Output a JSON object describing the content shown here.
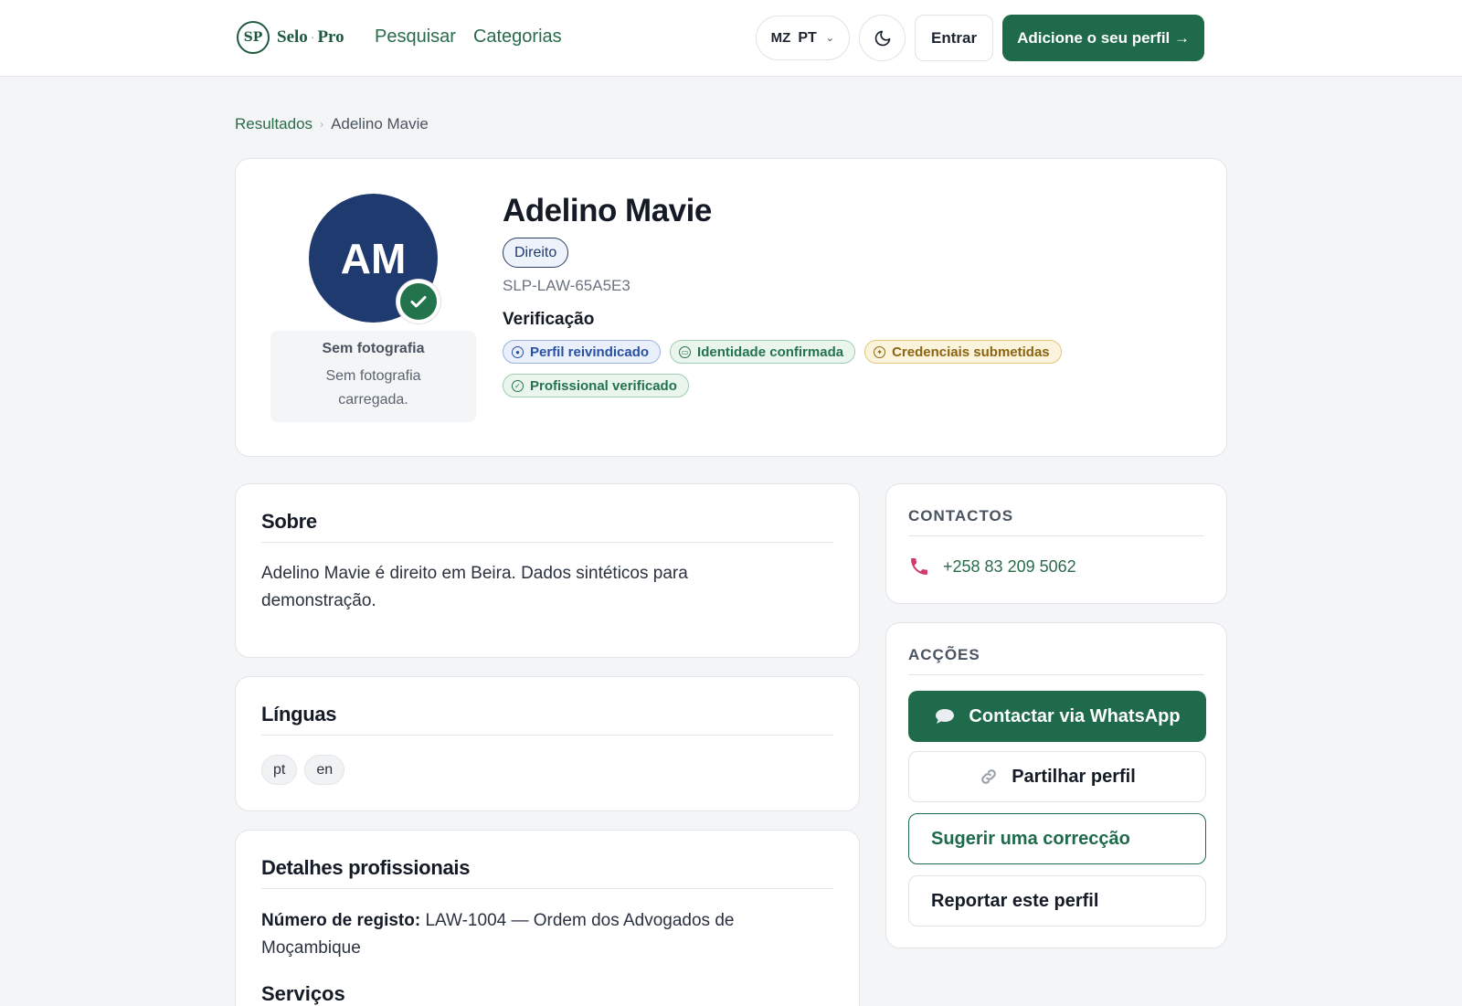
{
  "header": {
    "logo_mark": "SP",
    "logo_name": "Selo",
    "logo_sep": "·",
    "logo_suffix": "Pro",
    "nav": [
      "Pesquisar",
      "Categorias"
    ],
    "country": "MZ",
    "lang": "PT",
    "login": "Entrar",
    "cta": "Adicione o seu perfil →"
  },
  "breadcrumb": {
    "parent": "Resultados",
    "current": "Adelino Mavie"
  },
  "profile": {
    "initials": "AM",
    "name": "Adelino Mavie",
    "category": "Direito",
    "id": "SLP-LAW-65A5E3",
    "no_photo_title": "Sem fotografia",
    "no_photo_text": "Sem fotografia carregada.",
    "verification_title": "Verificação",
    "badges": [
      {
        "label": "Perfil reivindicado",
        "style": "blue",
        "icon": "user-circle-icon"
      },
      {
        "label": "Identidade confirmada",
        "style": "green",
        "icon": "id-card-icon"
      },
      {
        "label": "Credenciais submetidas",
        "style": "gold",
        "icon": "certificate-icon"
      },
      {
        "label": "Profissional verificado",
        "style": "green",
        "icon": "check-circle-icon"
      }
    ]
  },
  "about": {
    "title": "Sobre",
    "text": "Adelino Mavie é direito em Beira. Dados sintéticos para demonstração."
  },
  "languages": {
    "title": "Línguas",
    "items": [
      "pt",
      "en"
    ]
  },
  "details": {
    "title": "Detalhes profissionais",
    "reg_label": "Número de registo:",
    "reg_value": " LAW-1004 — Ordem dos Advogados de Moçambique",
    "services_title": "Serviços"
  },
  "contacts": {
    "title": "CONTACTOS",
    "phone": "+258 83 209 5062"
  },
  "actions": {
    "title": "ACÇÕES",
    "whatsapp": "Contactar via WhatsApp",
    "share": "Partilhar perfil",
    "suggest": "Sugerir uma correcção",
    "report": "Reportar este perfil"
  },
  "colors": {
    "brand": "#1e6a4a",
    "avatar": "#1e3a6e",
    "phone_icon": "#d13a6e"
  }
}
